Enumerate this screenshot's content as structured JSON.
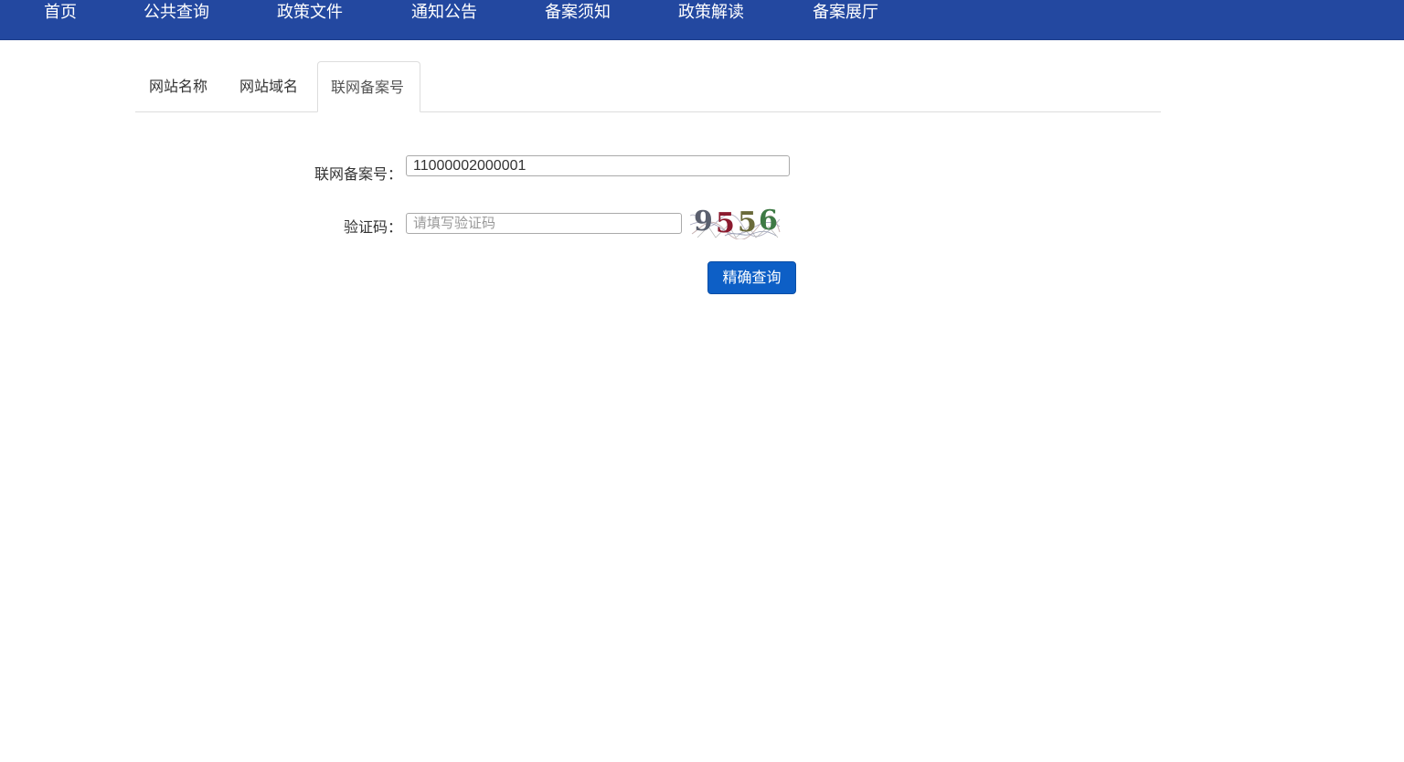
{
  "nav": {
    "items": [
      {
        "label": "首页"
      },
      {
        "label": "公共查询"
      },
      {
        "label": "政策文件"
      },
      {
        "label": "通知公告"
      },
      {
        "label": "备案须知"
      },
      {
        "label": "政策解读"
      },
      {
        "label": "备案展厅"
      }
    ]
  },
  "tabs": [
    {
      "label": "网站名称"
    },
    {
      "label": "网站域名"
    },
    {
      "label": "联网备案号",
      "active": true
    }
  ],
  "form": {
    "record_label": "联网备案号：",
    "record_value": "11000002000001",
    "captcha_label": "验证码：",
    "captcha_placeholder": "请填写验证码",
    "captcha_digits": [
      "9",
      "5",
      "5",
      "6"
    ],
    "captcha_colors": [
      "#5a5f6e",
      "#8b1a2e",
      "#6a6a3a",
      "#3e7a45"
    ],
    "submit_label": "精确查询"
  },
  "colors": {
    "nav_bg": "#2348a0",
    "button_bg": "#0d5fc6"
  }
}
